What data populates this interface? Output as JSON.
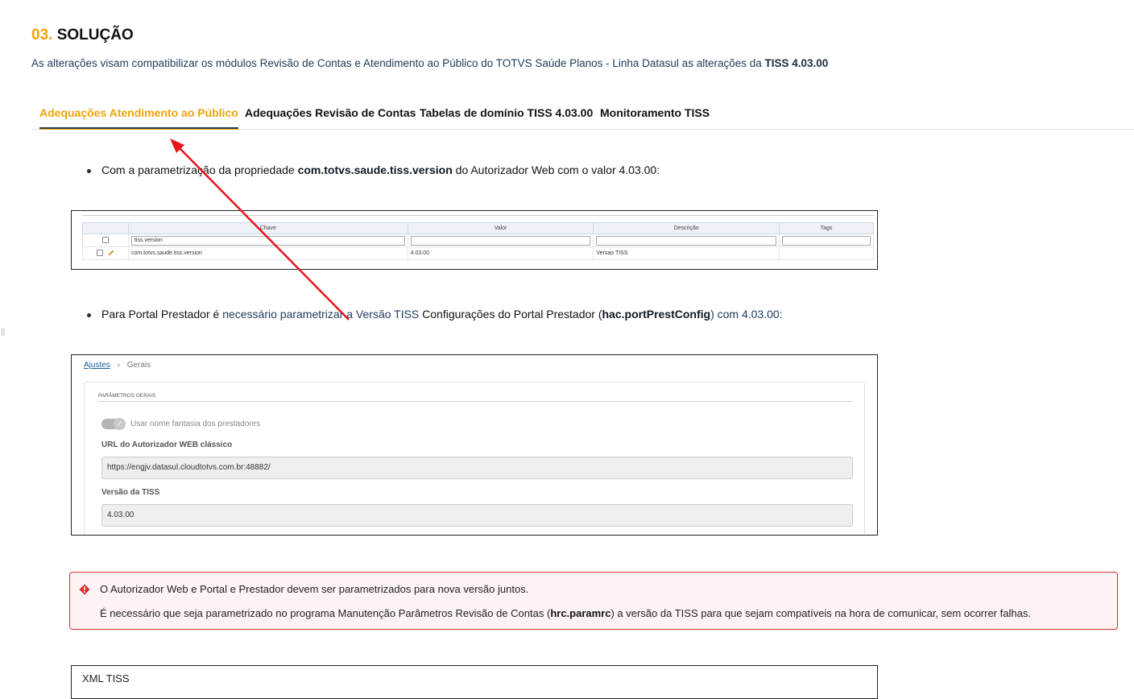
{
  "section": {
    "number": "03.",
    "title": "SOLUÇÃO"
  },
  "intro": {
    "text": "As alterações visam compatibilizar os módulos Revisão de Contas e Atendimento ao Público do TOTVS Saúde Planos - Linha Datasul as alterações da ",
    "bold": "TISS 4.03.00"
  },
  "tabs": [
    {
      "label": "Adequações Atendimento ao Público",
      "active": true
    },
    {
      "label": "Adequações Revisão de Contas"
    },
    {
      "label": "Tabelas de domínio TISS 4.03.00"
    },
    {
      "label": "Monitoramento TISS"
    }
  ],
  "bullet1": {
    "pre": "Com a parametrização da propriedade ",
    "bold": "com.totvs.saude.tiss.version",
    "post": " do Autorizador Web com o valor 4.03.00:"
  },
  "config_table": {
    "headers": [
      "Chave",
      "Valor",
      "Descrição",
      "Tags"
    ],
    "filter": {
      "key": "tiss.version"
    },
    "row": {
      "key": "com.totvs.saude.tiss.version",
      "value": "4.03.00",
      "description": "Versao TISS"
    }
  },
  "bullet2": {
    "pre": "Para Portal Prestador é ",
    "link": "necessário parametrizar a Versão TISS",
    "mid": " Configurações do Portal Prestador (",
    "bold": "hac.portPrestConfig",
    "post": ") com 4.03.00:"
  },
  "portal": {
    "breadcrumb_link": "Ajustes",
    "breadcrumb_sep": "›",
    "breadcrumb_current": "Gerais",
    "panel_title": "PARÂMETROS GERAIS",
    "toggle_label": "Usar nome fantasia dos prestadores",
    "url_label": "URL do Autorizador WEB clássico",
    "url_value": "https://engjv.datasul.cloudtotvs.com.br:48882/",
    "version_label": "Versão da TISS",
    "version_value": "4.03.00"
  },
  "alert": {
    "line1": "O Autorizador Web e Portal e Prestador devem ser parametrizados para nova versão juntos.",
    "line2_pre": "É necessário que seja parametrizado no programa Manutenção Parâmetros Revisão de Contas (",
    "line2_bold": "hrc.paramrc",
    "line2_post": ") a versão da TISS para que sejam compatíveis na hora de comunicar, sem ocorrer falhas.",
    "color": "#d32f2f"
  },
  "xml_box": {
    "label": "XML TISS"
  },
  "colors": {
    "accent": "#f0a30a",
    "tab_underline": "#2d3e50",
    "arrow": "#e8141b"
  }
}
